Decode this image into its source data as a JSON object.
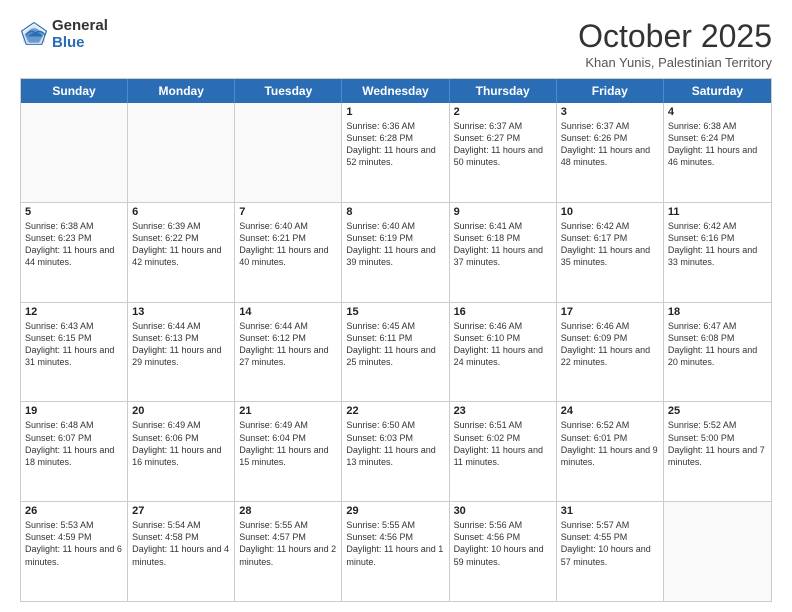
{
  "logo": {
    "general": "General",
    "blue": "Blue"
  },
  "title": "October 2025",
  "subtitle": "Khan Yunis, Palestinian Territory",
  "days": [
    "Sunday",
    "Monday",
    "Tuesday",
    "Wednesday",
    "Thursday",
    "Friday",
    "Saturday"
  ],
  "weeks": [
    [
      {
        "day": "",
        "text": ""
      },
      {
        "day": "",
        "text": ""
      },
      {
        "day": "",
        "text": ""
      },
      {
        "day": "1",
        "text": "Sunrise: 6:36 AM\nSunset: 6:28 PM\nDaylight: 11 hours and 52 minutes."
      },
      {
        "day": "2",
        "text": "Sunrise: 6:37 AM\nSunset: 6:27 PM\nDaylight: 11 hours and 50 minutes."
      },
      {
        "day": "3",
        "text": "Sunrise: 6:37 AM\nSunset: 6:26 PM\nDaylight: 11 hours and 48 minutes."
      },
      {
        "day": "4",
        "text": "Sunrise: 6:38 AM\nSunset: 6:24 PM\nDaylight: 11 hours and 46 minutes."
      }
    ],
    [
      {
        "day": "5",
        "text": "Sunrise: 6:38 AM\nSunset: 6:23 PM\nDaylight: 11 hours and 44 minutes."
      },
      {
        "day": "6",
        "text": "Sunrise: 6:39 AM\nSunset: 6:22 PM\nDaylight: 11 hours and 42 minutes."
      },
      {
        "day": "7",
        "text": "Sunrise: 6:40 AM\nSunset: 6:21 PM\nDaylight: 11 hours and 40 minutes."
      },
      {
        "day": "8",
        "text": "Sunrise: 6:40 AM\nSunset: 6:19 PM\nDaylight: 11 hours and 39 minutes."
      },
      {
        "day": "9",
        "text": "Sunrise: 6:41 AM\nSunset: 6:18 PM\nDaylight: 11 hours and 37 minutes."
      },
      {
        "day": "10",
        "text": "Sunrise: 6:42 AM\nSunset: 6:17 PM\nDaylight: 11 hours and 35 minutes."
      },
      {
        "day": "11",
        "text": "Sunrise: 6:42 AM\nSunset: 6:16 PM\nDaylight: 11 hours and 33 minutes."
      }
    ],
    [
      {
        "day": "12",
        "text": "Sunrise: 6:43 AM\nSunset: 6:15 PM\nDaylight: 11 hours and 31 minutes."
      },
      {
        "day": "13",
        "text": "Sunrise: 6:44 AM\nSunset: 6:13 PM\nDaylight: 11 hours and 29 minutes."
      },
      {
        "day": "14",
        "text": "Sunrise: 6:44 AM\nSunset: 6:12 PM\nDaylight: 11 hours and 27 minutes."
      },
      {
        "day": "15",
        "text": "Sunrise: 6:45 AM\nSunset: 6:11 PM\nDaylight: 11 hours and 25 minutes."
      },
      {
        "day": "16",
        "text": "Sunrise: 6:46 AM\nSunset: 6:10 PM\nDaylight: 11 hours and 24 minutes."
      },
      {
        "day": "17",
        "text": "Sunrise: 6:46 AM\nSunset: 6:09 PM\nDaylight: 11 hours and 22 minutes."
      },
      {
        "day": "18",
        "text": "Sunrise: 6:47 AM\nSunset: 6:08 PM\nDaylight: 11 hours and 20 minutes."
      }
    ],
    [
      {
        "day": "19",
        "text": "Sunrise: 6:48 AM\nSunset: 6:07 PM\nDaylight: 11 hours and 18 minutes."
      },
      {
        "day": "20",
        "text": "Sunrise: 6:49 AM\nSunset: 6:06 PM\nDaylight: 11 hours and 16 minutes."
      },
      {
        "day": "21",
        "text": "Sunrise: 6:49 AM\nSunset: 6:04 PM\nDaylight: 11 hours and 15 minutes."
      },
      {
        "day": "22",
        "text": "Sunrise: 6:50 AM\nSunset: 6:03 PM\nDaylight: 11 hours and 13 minutes."
      },
      {
        "day": "23",
        "text": "Sunrise: 6:51 AM\nSunset: 6:02 PM\nDaylight: 11 hours and 11 minutes."
      },
      {
        "day": "24",
        "text": "Sunrise: 6:52 AM\nSunset: 6:01 PM\nDaylight: 11 hours and 9 minutes."
      },
      {
        "day": "25",
        "text": "Sunrise: 5:52 AM\nSunset: 5:00 PM\nDaylight: 11 hours and 7 minutes."
      }
    ],
    [
      {
        "day": "26",
        "text": "Sunrise: 5:53 AM\nSunset: 4:59 PM\nDaylight: 11 hours and 6 minutes."
      },
      {
        "day": "27",
        "text": "Sunrise: 5:54 AM\nSunset: 4:58 PM\nDaylight: 11 hours and 4 minutes."
      },
      {
        "day": "28",
        "text": "Sunrise: 5:55 AM\nSunset: 4:57 PM\nDaylight: 11 hours and 2 minutes."
      },
      {
        "day": "29",
        "text": "Sunrise: 5:55 AM\nSunset: 4:56 PM\nDaylight: 11 hours and 1 minute."
      },
      {
        "day": "30",
        "text": "Sunrise: 5:56 AM\nSunset: 4:56 PM\nDaylight: 10 hours and 59 minutes."
      },
      {
        "day": "31",
        "text": "Sunrise: 5:57 AM\nSunset: 4:55 PM\nDaylight: 10 hours and 57 minutes."
      },
      {
        "day": "",
        "text": ""
      }
    ]
  ]
}
